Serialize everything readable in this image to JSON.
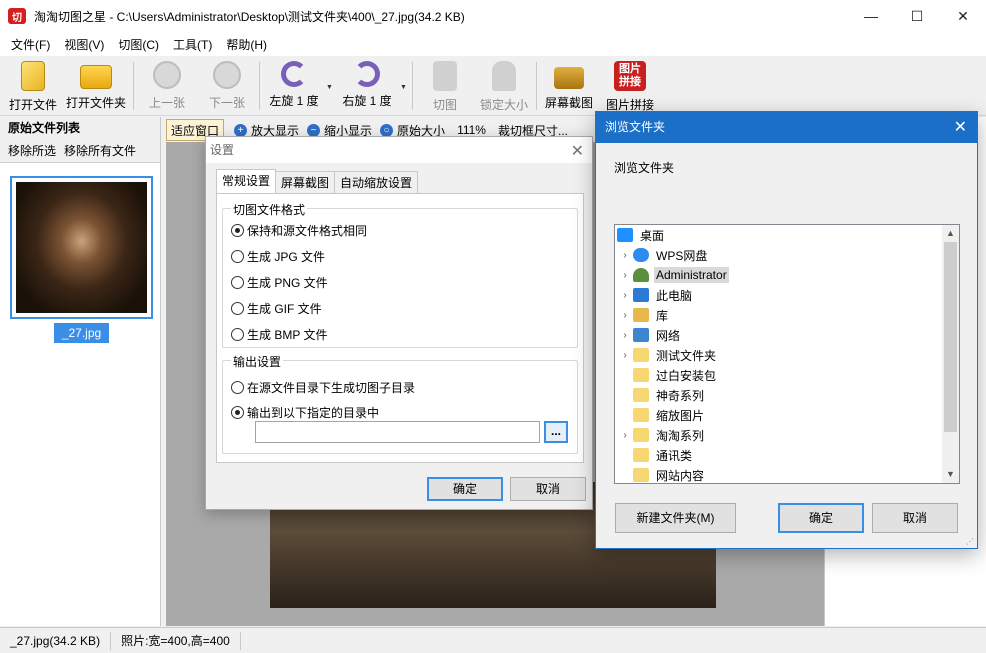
{
  "window": {
    "app_icon": "切",
    "title": "淘淘切图之星 - C:\\Users\\Administrator\\Desktop\\测试文件夹\\400\\_27.jpg(34.2 KB)",
    "controls": {
      "minimize": "—",
      "maximize": "☐",
      "close": "✕"
    }
  },
  "menu": {
    "items": [
      "文件(F)",
      "视图(V)",
      "切图(C)",
      "工具(T)",
      "帮助(H)"
    ]
  },
  "toolbar": {
    "open_file": "打开文件",
    "open_folder": "打开文件夹",
    "prev": "上一张",
    "next": "下一张",
    "rotate_left": "左旋 1 度",
    "rotate_right": "右旋 1 度",
    "cut": "切图",
    "lock_size": "锁定大小",
    "screenshot": "屏幕截图",
    "stitch": "图片拼接",
    "stitch_icon_text": "图片\n拼接"
  },
  "left_panel": {
    "header": "原始文件列表",
    "remove_selected": "移除所选",
    "remove_all": "移除所有文件",
    "files": [
      {
        "name": "_27.jpg"
      }
    ]
  },
  "view_toolbar": {
    "fit_window": "适应窗口",
    "zoom_in": "放大显示",
    "zoom_out": "缩小显示",
    "original_size": "原始大小",
    "zoom_level": "111%",
    "crop_box_size": "裁切框尺寸..."
  },
  "status": {
    "file": "_27.jpg(34.2 KB)",
    "dimensions": "照片:宽=400,高=400"
  },
  "settings_dialog": {
    "title": "设置",
    "tabs": [
      "常规设置",
      "屏幕截图",
      "自动缩放设置"
    ],
    "format_group": "切图文件格式",
    "format_options": [
      "保持和源文件格式相同",
      "生成 JPG 文件",
      "生成 PNG 文件",
      "生成 GIF 文件",
      "生成 BMP 文件"
    ],
    "format_selected": 0,
    "output_group": "输出设置",
    "output_options": [
      "在源文件目录下生成切图子目录",
      "输出到以下指定的目录中"
    ],
    "output_selected": 1,
    "output_dir": "",
    "browse_label": "...",
    "ok": "确定",
    "cancel": "取消"
  },
  "browse_dialog": {
    "title": "浏览文件夹",
    "description": "浏览文件夹",
    "tree": [
      {
        "label": "桌面",
        "icon": "desktop-icon",
        "color": "#1e90ff",
        "expandable": false,
        "indent": 0
      },
      {
        "label": "WPS网盘",
        "icon": "cloud-icon",
        "color": "#2d8cf0",
        "expandable": true,
        "indent": 1
      },
      {
        "label": "Administrator",
        "icon": "user-icon",
        "color": "#5a8f3c",
        "expandable": true,
        "indent": 1,
        "selected": true
      },
      {
        "label": "此电脑",
        "icon": "computer-icon",
        "color": "#2b7bd4",
        "expandable": true,
        "indent": 1
      },
      {
        "label": "库",
        "icon": "library-icon",
        "color": "#e8b84a",
        "expandable": true,
        "indent": 1
      },
      {
        "label": "网络",
        "icon": "network-icon",
        "color": "#3c86d0",
        "expandable": true,
        "indent": 1
      },
      {
        "label": "测试文件夹",
        "icon": "folder-icon",
        "color": "#f7d774",
        "expandable": true,
        "indent": 1
      },
      {
        "label": "过白安装包",
        "icon": "folder-icon",
        "color": "#f7d774",
        "expandable": false,
        "indent": 1
      },
      {
        "label": "神奇系列",
        "icon": "folder-icon",
        "color": "#f7d774",
        "expandable": false,
        "indent": 1
      },
      {
        "label": "缩放图片",
        "icon": "folder-icon",
        "color": "#f7d774",
        "expandable": false,
        "indent": 1
      },
      {
        "label": "淘淘系列",
        "icon": "folder-icon",
        "color": "#f7d774",
        "expandable": true,
        "indent": 1
      },
      {
        "label": "通讯类",
        "icon": "folder-icon",
        "color": "#f7d774",
        "expandable": false,
        "indent": 1
      },
      {
        "label": "网站内容",
        "icon": "folder-icon",
        "color": "#f7d774",
        "expandable": false,
        "indent": 1
      }
    ],
    "new_folder": "新建文件夹(M)",
    "ok": "确定",
    "cancel": "取消"
  }
}
